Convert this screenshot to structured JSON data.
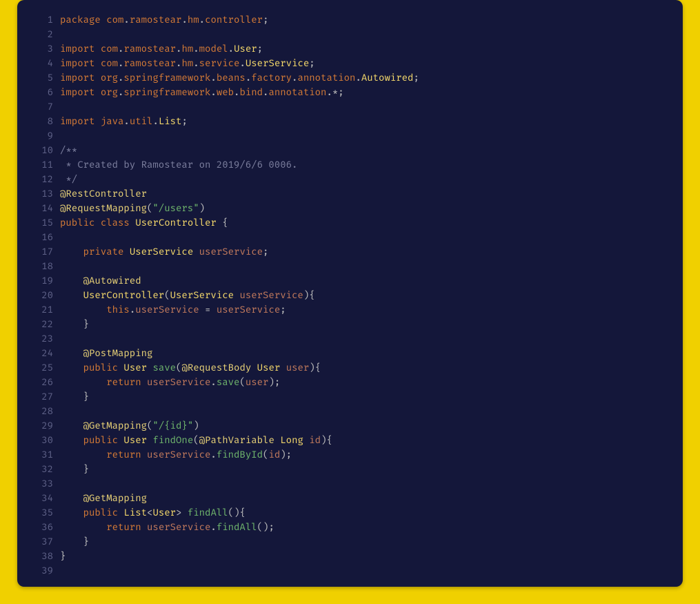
{
  "colors": {
    "outer_border": "#f0d000",
    "panel_bg": "#14173a",
    "gutter_fg": "#5e6187",
    "keyword": "#d47a36",
    "type": "#f5d96b",
    "annotation": "#e9d277",
    "function": "#6fb56c",
    "string": "#6fb56c",
    "identifier": "#c27a5c",
    "comment": "#7c7f9e",
    "punct": "#bdbdbd"
  },
  "line_count": 39,
  "code_lines": [
    {
      "n": 1,
      "tokens": [
        {
          "t": "package",
          "c": "kw"
        },
        {
          "t": " "
        },
        {
          "t": "com",
          "c": "pkg"
        },
        {
          "t": ".",
          "c": "punct"
        },
        {
          "t": "ramostear",
          "c": "pkg"
        },
        {
          "t": ".",
          "c": "punct"
        },
        {
          "t": "hm",
          "c": "pkg"
        },
        {
          "t": ".",
          "c": "punct"
        },
        {
          "t": "controller",
          "c": "pkg"
        },
        {
          "t": ";",
          "c": "punct"
        }
      ]
    },
    {
      "n": 2,
      "tokens": []
    },
    {
      "n": 3,
      "tokens": [
        {
          "t": "import",
          "c": "kw"
        },
        {
          "t": " "
        },
        {
          "t": "com",
          "c": "pkg"
        },
        {
          "t": ".",
          "c": "punct"
        },
        {
          "t": "ramostear",
          "c": "pkg"
        },
        {
          "t": ".",
          "c": "punct"
        },
        {
          "t": "hm",
          "c": "pkg"
        },
        {
          "t": ".",
          "c": "punct"
        },
        {
          "t": "model",
          "c": "pkg"
        },
        {
          "t": ".",
          "c": "punct"
        },
        {
          "t": "User",
          "c": "type"
        },
        {
          "t": ";",
          "c": "punct"
        }
      ]
    },
    {
      "n": 4,
      "tokens": [
        {
          "t": "import",
          "c": "kw"
        },
        {
          "t": " "
        },
        {
          "t": "com",
          "c": "pkg"
        },
        {
          "t": ".",
          "c": "punct"
        },
        {
          "t": "ramostear",
          "c": "pkg"
        },
        {
          "t": ".",
          "c": "punct"
        },
        {
          "t": "hm",
          "c": "pkg"
        },
        {
          "t": ".",
          "c": "punct"
        },
        {
          "t": "service",
          "c": "pkg"
        },
        {
          "t": ".",
          "c": "punct"
        },
        {
          "t": "UserService",
          "c": "type"
        },
        {
          "t": ";",
          "c": "punct"
        }
      ]
    },
    {
      "n": 5,
      "tokens": [
        {
          "t": "import",
          "c": "kw"
        },
        {
          "t": " "
        },
        {
          "t": "org",
          "c": "pkg"
        },
        {
          "t": ".",
          "c": "punct"
        },
        {
          "t": "springframework",
          "c": "pkg"
        },
        {
          "t": ".",
          "c": "punct"
        },
        {
          "t": "beans",
          "c": "pkg"
        },
        {
          "t": ".",
          "c": "punct"
        },
        {
          "t": "factory",
          "c": "pkg"
        },
        {
          "t": ".",
          "c": "punct"
        },
        {
          "t": "annotation",
          "c": "pkg"
        },
        {
          "t": ".",
          "c": "punct"
        },
        {
          "t": "Autowired",
          "c": "type"
        },
        {
          "t": ";",
          "c": "punct"
        }
      ]
    },
    {
      "n": 6,
      "tokens": [
        {
          "t": "import",
          "c": "kw"
        },
        {
          "t": " "
        },
        {
          "t": "org",
          "c": "pkg"
        },
        {
          "t": ".",
          "c": "punct"
        },
        {
          "t": "springframework",
          "c": "pkg"
        },
        {
          "t": ".",
          "c": "punct"
        },
        {
          "t": "web",
          "c": "pkg"
        },
        {
          "t": ".",
          "c": "punct"
        },
        {
          "t": "bind",
          "c": "pkg"
        },
        {
          "t": ".",
          "c": "punct"
        },
        {
          "t": "annotation",
          "c": "pkg"
        },
        {
          "t": ".",
          "c": "punct"
        },
        {
          "t": "*",
          "c": "wild"
        },
        {
          "t": ";",
          "c": "punct"
        }
      ]
    },
    {
      "n": 7,
      "tokens": []
    },
    {
      "n": 8,
      "tokens": [
        {
          "t": "import",
          "c": "kw"
        },
        {
          "t": " "
        },
        {
          "t": "java",
          "c": "pkg"
        },
        {
          "t": ".",
          "c": "punct"
        },
        {
          "t": "util",
          "c": "pkg"
        },
        {
          "t": ".",
          "c": "punct"
        },
        {
          "t": "List",
          "c": "type"
        },
        {
          "t": ";",
          "c": "punct"
        }
      ]
    },
    {
      "n": 9,
      "tokens": []
    },
    {
      "n": 10,
      "tokens": [
        {
          "t": "/**",
          "c": "cmt"
        }
      ]
    },
    {
      "n": 11,
      "tokens": [
        {
          "t": " * Created by Ramostear on 2019/6/6 0006.",
          "c": "cmt"
        }
      ]
    },
    {
      "n": 12,
      "tokens": [
        {
          "t": " */",
          "c": "cmt"
        }
      ]
    },
    {
      "n": 13,
      "tokens": [
        {
          "t": "@RestController",
          "c": "ann"
        }
      ]
    },
    {
      "n": 14,
      "tokens": [
        {
          "t": "@RequestMapping",
          "c": "ann"
        },
        {
          "t": "(",
          "c": "punct"
        },
        {
          "t": "\"/users\"",
          "c": "str"
        },
        {
          "t": ")",
          "c": "punct"
        }
      ]
    },
    {
      "n": 15,
      "tokens": [
        {
          "t": "public",
          "c": "kw"
        },
        {
          "t": " "
        },
        {
          "t": "class",
          "c": "kw"
        },
        {
          "t": " "
        },
        {
          "t": "UserController",
          "c": "type"
        },
        {
          "t": " "
        },
        {
          "t": "{",
          "c": "punct"
        }
      ]
    },
    {
      "n": 16,
      "tokens": []
    },
    {
      "n": 17,
      "tokens": [
        {
          "t": "    "
        },
        {
          "t": "private",
          "c": "kw"
        },
        {
          "t": " "
        },
        {
          "t": "UserService",
          "c": "type"
        },
        {
          "t": " "
        },
        {
          "t": "userService",
          "c": "id"
        },
        {
          "t": ";",
          "c": "punct"
        }
      ]
    },
    {
      "n": 18,
      "tokens": []
    },
    {
      "n": 19,
      "tokens": [
        {
          "t": "    "
        },
        {
          "t": "@Autowired",
          "c": "ann"
        }
      ]
    },
    {
      "n": 20,
      "tokens": [
        {
          "t": "    "
        },
        {
          "t": "UserController",
          "c": "type"
        },
        {
          "t": "(",
          "c": "punct"
        },
        {
          "t": "UserService",
          "c": "type"
        },
        {
          "t": " "
        },
        {
          "t": "userService",
          "c": "id"
        },
        {
          "t": ")",
          "c": "punct"
        },
        {
          "t": "{",
          "c": "punct"
        }
      ]
    },
    {
      "n": 21,
      "tokens": [
        {
          "t": "        "
        },
        {
          "t": "this",
          "c": "kw"
        },
        {
          "t": ".",
          "c": "punct"
        },
        {
          "t": "userService",
          "c": "id"
        },
        {
          "t": " "
        },
        {
          "t": "=",
          "c": "op"
        },
        {
          "t": " "
        },
        {
          "t": "userService",
          "c": "id"
        },
        {
          "t": ";",
          "c": "punct"
        }
      ]
    },
    {
      "n": 22,
      "tokens": [
        {
          "t": "    "
        },
        {
          "t": "}",
          "c": "punct"
        }
      ]
    },
    {
      "n": 23,
      "tokens": []
    },
    {
      "n": 24,
      "tokens": [
        {
          "t": "    "
        },
        {
          "t": "@PostMapping",
          "c": "ann"
        }
      ]
    },
    {
      "n": 25,
      "tokens": [
        {
          "t": "    "
        },
        {
          "t": "public",
          "c": "kw"
        },
        {
          "t": " "
        },
        {
          "t": "User",
          "c": "type"
        },
        {
          "t": " "
        },
        {
          "t": "save",
          "c": "fn"
        },
        {
          "t": "(",
          "c": "punct"
        },
        {
          "t": "@RequestBody",
          "c": "ann"
        },
        {
          "t": " "
        },
        {
          "t": "User",
          "c": "type"
        },
        {
          "t": " "
        },
        {
          "t": "user",
          "c": "id"
        },
        {
          "t": ")",
          "c": "punct"
        },
        {
          "t": "{",
          "c": "punct"
        }
      ]
    },
    {
      "n": 26,
      "tokens": [
        {
          "t": "        "
        },
        {
          "t": "return",
          "c": "kw"
        },
        {
          "t": " "
        },
        {
          "t": "userService",
          "c": "id"
        },
        {
          "t": ".",
          "c": "punct"
        },
        {
          "t": "save",
          "c": "fn"
        },
        {
          "t": "(",
          "c": "punct"
        },
        {
          "t": "user",
          "c": "id"
        },
        {
          "t": ")",
          "c": "punct"
        },
        {
          "t": ";",
          "c": "punct"
        }
      ]
    },
    {
      "n": 27,
      "tokens": [
        {
          "t": "    "
        },
        {
          "t": "}",
          "c": "punct"
        }
      ]
    },
    {
      "n": 28,
      "tokens": []
    },
    {
      "n": 29,
      "tokens": [
        {
          "t": "    "
        },
        {
          "t": "@GetMapping",
          "c": "ann"
        },
        {
          "t": "(",
          "c": "punct"
        },
        {
          "t": "\"/{id}\"",
          "c": "str"
        },
        {
          "t": ")",
          "c": "punct"
        }
      ]
    },
    {
      "n": 30,
      "tokens": [
        {
          "t": "    "
        },
        {
          "t": "public",
          "c": "kw"
        },
        {
          "t": " "
        },
        {
          "t": "User",
          "c": "type"
        },
        {
          "t": " "
        },
        {
          "t": "findOne",
          "c": "fn"
        },
        {
          "t": "(",
          "c": "punct"
        },
        {
          "t": "@PathVariable",
          "c": "ann"
        },
        {
          "t": " "
        },
        {
          "t": "Long",
          "c": "type"
        },
        {
          "t": " "
        },
        {
          "t": "id",
          "c": "id"
        },
        {
          "t": ")",
          "c": "punct"
        },
        {
          "t": "{",
          "c": "punct"
        }
      ]
    },
    {
      "n": 31,
      "tokens": [
        {
          "t": "        "
        },
        {
          "t": "return",
          "c": "kw"
        },
        {
          "t": " "
        },
        {
          "t": "userService",
          "c": "id"
        },
        {
          "t": ".",
          "c": "punct"
        },
        {
          "t": "findById",
          "c": "fn"
        },
        {
          "t": "(",
          "c": "punct"
        },
        {
          "t": "id",
          "c": "id"
        },
        {
          "t": ")",
          "c": "punct"
        },
        {
          "t": ";",
          "c": "punct"
        }
      ]
    },
    {
      "n": 32,
      "tokens": [
        {
          "t": "    "
        },
        {
          "t": "}",
          "c": "punct"
        }
      ]
    },
    {
      "n": 33,
      "tokens": []
    },
    {
      "n": 34,
      "tokens": [
        {
          "t": "    "
        },
        {
          "t": "@GetMapping",
          "c": "ann"
        }
      ]
    },
    {
      "n": 35,
      "tokens": [
        {
          "t": "    "
        },
        {
          "t": "public",
          "c": "kw"
        },
        {
          "t": " "
        },
        {
          "t": "List",
          "c": "type"
        },
        {
          "t": "<",
          "c": "punct"
        },
        {
          "t": "User",
          "c": "type"
        },
        {
          "t": ">",
          "c": "punct"
        },
        {
          "t": " "
        },
        {
          "t": "findAll",
          "c": "fn"
        },
        {
          "t": "(",
          "c": "punct"
        },
        {
          "t": ")",
          "c": "punct"
        },
        {
          "t": "{",
          "c": "punct"
        }
      ]
    },
    {
      "n": 36,
      "tokens": [
        {
          "t": "        "
        },
        {
          "t": "return",
          "c": "kw"
        },
        {
          "t": " "
        },
        {
          "t": "userService",
          "c": "id"
        },
        {
          "t": ".",
          "c": "punct"
        },
        {
          "t": "findAll",
          "c": "fn"
        },
        {
          "t": "(",
          "c": "punct"
        },
        {
          "t": ")",
          "c": "punct"
        },
        {
          "t": ";",
          "c": "punct"
        }
      ]
    },
    {
      "n": 37,
      "tokens": [
        {
          "t": "    "
        },
        {
          "t": "}",
          "c": "punct"
        }
      ]
    },
    {
      "n": 38,
      "tokens": [
        {
          "t": "}",
          "c": "punct"
        }
      ]
    },
    {
      "n": 39,
      "tokens": []
    }
  ]
}
